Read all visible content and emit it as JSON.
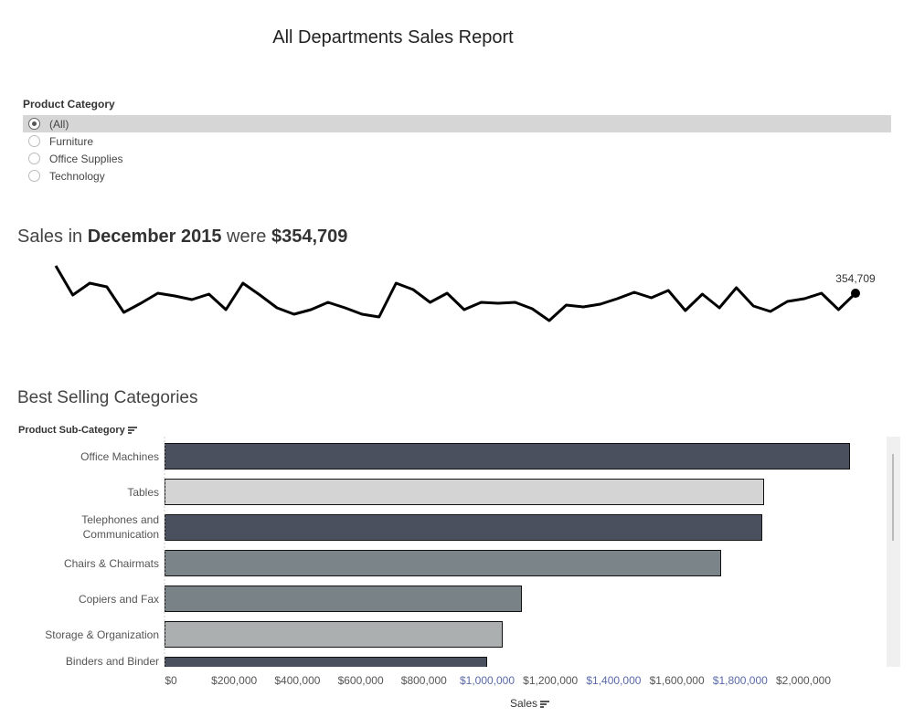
{
  "title": "All Departments Sales Report",
  "filter": {
    "title": "Product Category",
    "options": [
      "(All)",
      "Furniture",
      "Office Supplies",
      "Technology"
    ],
    "selected": "(All)"
  },
  "kpi": {
    "prefix": "Sales in ",
    "period": "December 2015",
    "middle": " were ",
    "value": "$354,709"
  },
  "trend_chart": {
    "type": "line",
    "values": [
      505000,
      345000,
      410000,
      390000,
      250000,
      300000,
      355000,
      340000,
      320000,
      350000,
      265000,
      410000,
      345000,
      275000,
      240000,
      265000,
      305000,
      275000,
      240000,
      225000,
      410000,
      375000,
      305000,
      355000,
      265000,
      305000,
      300000,
      305000,
      270000,
      205000,
      290000,
      280000,
      295000,
      325000,
      360000,
      330000,
      370000,
      260000,
      350000,
      275000,
      385000,
      285000,
      255000,
      310000,
      325000,
      355000,
      265000,
      354709
    ],
    "ylim": [
      200000,
      510000
    ],
    "last_label": "354,709",
    "color": "#000000"
  },
  "chart_data": {
    "type": "bar",
    "orientation": "horizontal",
    "title": "Best Selling Categories",
    "ylabel": "Product Sub-Category",
    "xlabel": "Sales",
    "categories": [
      "Office Machines",
      "Tables",
      "Telephones and Communication",
      "Chairs & Chairmats",
      "Copiers and Fax",
      "Storage & Organization",
      "Binders and Binder"
    ],
    "values": [
      2168000,
      1896000,
      1890000,
      1760000,
      1130000,
      1069000,
      1020000
    ],
    "colors": [
      "#4a505e",
      "#d4d4d4",
      "#4a505e",
      "#7b8489",
      "#798287",
      "#abafb0",
      "#4a505e"
    ],
    "xlim": [
      0,
      2000000
    ],
    "xticks": [
      "$0",
      "$200,000",
      "$400,000",
      "$600,000",
      "$800,000",
      "$1,000,000",
      "$1,200,000",
      "$1,400,000",
      "$1,600,000",
      "$1,800,000",
      "$2,000,000"
    ],
    "grid": false
  }
}
